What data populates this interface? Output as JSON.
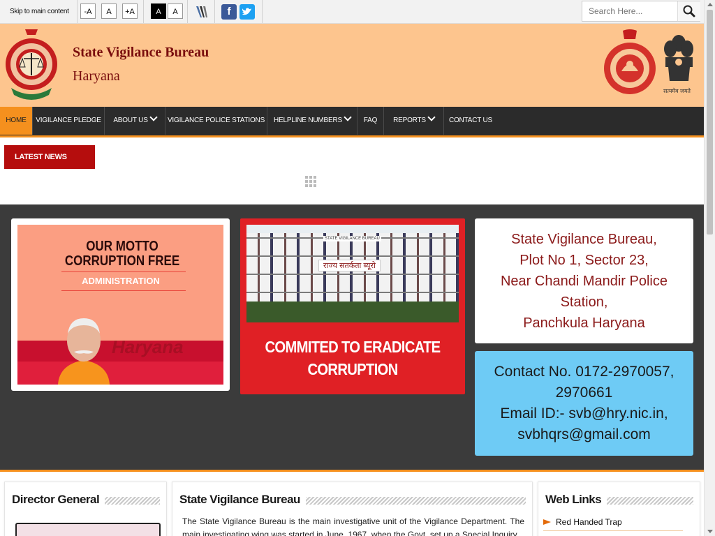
{
  "topbar": {
    "skip_link": "Skip to main content",
    "font_small": "-A",
    "font_normal": "A",
    "font_large": "+A",
    "contrast_dark": "A",
    "contrast_light": "A",
    "search_placeholder": "Search Here..."
  },
  "header": {
    "title": "State Vigilance Bureau",
    "subtitle": "Haryana",
    "emblem_caption": "सत्यमेव जयते"
  },
  "nav": {
    "items": [
      {
        "label": "HOME"
      },
      {
        "label": "VIGILANCE PLEDGE"
      },
      {
        "label": "ABOUT US"
      },
      {
        "label": "VIGILANCE POLICE STATIONS"
      },
      {
        "label": "HELPLINE NUMBERS"
      },
      {
        "label": "FAQ"
      },
      {
        "label": "REPORTS"
      },
      {
        "label": "CONTACT US"
      }
    ]
  },
  "news": {
    "label": "LATEST NEWS"
  },
  "banner": {
    "motto_line1": "OUR MOTTO",
    "motto_line2": "CORRUPTION FREE",
    "motto_line3": "ADMINISTRATION",
    "motto_watermark": "Haryana",
    "building_sign": "STATE VIGILANCE BUREAU",
    "building_hindi": "राज्य सतर्कता ब्यूरो",
    "commit_line1": "COMMITED TO ERADICATE",
    "commit_line2": "CORRUPTION",
    "address_lines": [
      "State Vigilance Bureau,",
      "Plot No 1, Sector 23,",
      "Near Chandi Mandir Police",
      "Station,",
      "Panchkula Haryana"
    ],
    "contact_lines": [
      "Contact No. 0172-2970057,",
      "2970661",
      "Email ID:- svb@hry.nic.in,",
      "svbhqrs@gmail.com"
    ]
  },
  "panels": {
    "director_title": "Director General",
    "svb_title": "State Vigilance Bureau",
    "svb_text": "The State Vigilance Bureau is the main investigative unit of the Vigilance Department. The main investigating wing was started in June, 1967, when the Govt. set up a Special Inquiry",
    "weblinks_title": "Web Links",
    "weblinks": [
      "Red Handed Trap"
    ]
  },
  "colors": {
    "header_bg": "#fdc58e",
    "nav_bg": "#2b2b2b",
    "accent": "#f5901e",
    "news_red": "#b50d0d",
    "commit_red": "#e02025",
    "contact_blue": "#6ecbf5",
    "title_maroon": "#7a0e0e"
  }
}
